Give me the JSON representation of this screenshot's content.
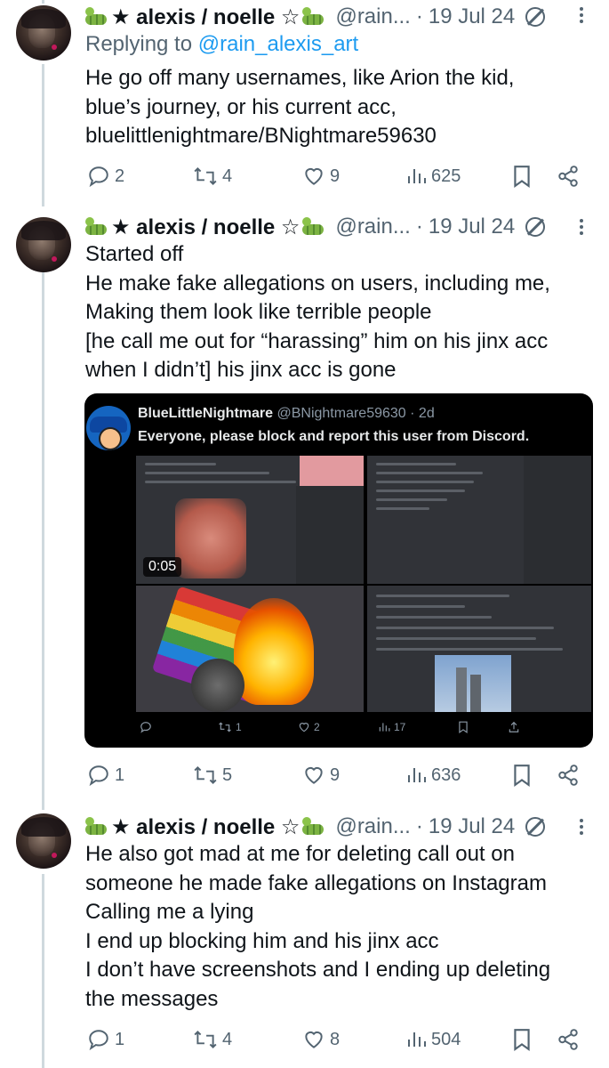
{
  "colors": {
    "accent": "#1d9bf0",
    "muted": "#536471",
    "text": "#0f1419",
    "thread_line": "#cfd9de"
  },
  "tweets": [
    {
      "author": "★ alexis / noelle ☆",
      "handle": "@rain...",
      "time": "19 Jul 24",
      "reply_prefix": "Replying to ",
      "reply_handle": "@rain_alexis_art",
      "lines": [
        "He go off many usernames, like Arion the kid,",
        "blue’s journey, or his current acc,",
        "bluelittlenightmare/BNightmare59630"
      ],
      "replies": "2",
      "retweets": "4",
      "likes": "9",
      "views": "625"
    },
    {
      "author": "★ alexis / noelle ☆",
      "handle": "@rain...",
      "time": "19 Jul 24",
      "lines": [
        "Started off",
        "He make fake allegations on users, including me,",
        "Making them look like terrible people",
        "[he call me out for “harassing” him on his jinx acc",
        "when I didn’t] his jinx acc is gone"
      ],
      "replies": "1",
      "retweets": "5",
      "likes": "9",
      "views": "636"
    },
    {
      "author": "★ alexis / noelle ☆",
      "handle": "@rain...",
      "time": "19 Jul 24",
      "lines": [
        "He also got mad at me for deleting call out on",
        "someone he made fake allegations on Instagram",
        "Calling me a lying",
        "I end up blocking him and his jinx acc",
        "I don’t have screenshots and I ending up deleting",
        "the messages"
      ],
      "replies": "1",
      "retweets": "4",
      "likes": "8",
      "views": "504"
    }
  ],
  "embedded": {
    "name": "BlueLittleNightmare",
    "handle": "@BNightmare59630",
    "time": "· 2d",
    "text": "Everyone, please block and report this user from Discord.",
    "video_time": "0:05",
    "retweets": "1",
    "likes": "2",
    "views": "17"
  }
}
